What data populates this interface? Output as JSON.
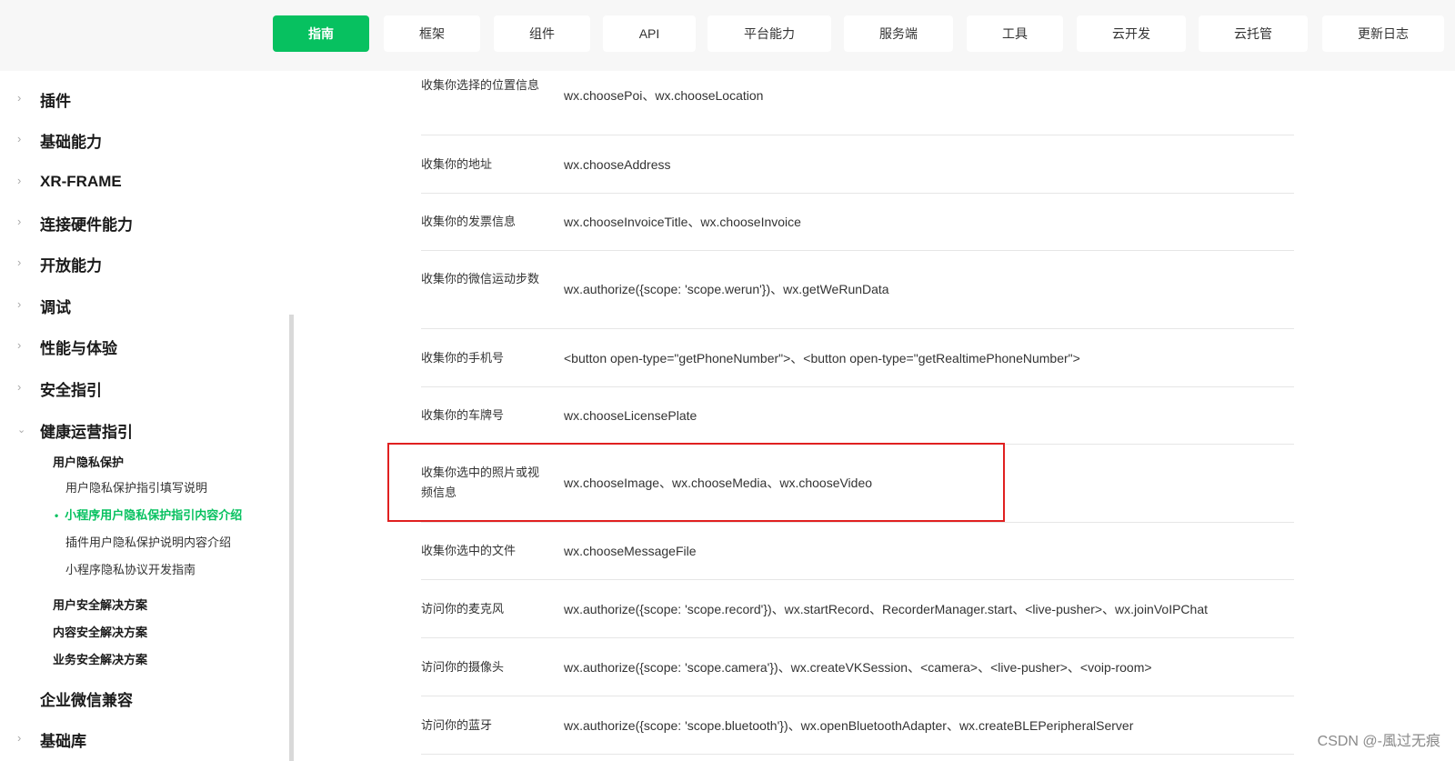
{
  "top_nav": {
    "tabs": [
      {
        "label": "指南",
        "active": true
      },
      {
        "label": "框架"
      },
      {
        "label": "组件"
      },
      {
        "label": "API"
      },
      {
        "label": "平台能力"
      },
      {
        "label": "服务端"
      },
      {
        "label": "工具"
      },
      {
        "label": "云开发"
      },
      {
        "label": "云托管"
      },
      {
        "label": "更新日志"
      }
    ]
  },
  "sidebar": {
    "items": [
      {
        "label": "插件"
      },
      {
        "label": "基础能力"
      },
      {
        "label": "XR-FRAME"
      },
      {
        "label": "连接硬件能力"
      },
      {
        "label": "开放能力"
      },
      {
        "label": "调试"
      },
      {
        "label": "性能与体验"
      },
      {
        "label": "安全指引"
      },
      {
        "label": "健康运营指引"
      }
    ],
    "sub": {
      "privacy_group": "用户隐私保护",
      "privacy_items": [
        "用户隐私保护指引填写说明",
        "小程序用户隐私保护指引内容介绍",
        "插件用户隐私保护说明内容介绍",
        "小程序隐私协议开发指南"
      ],
      "active_bullet": "•",
      "groups": [
        "用户安全解决方案",
        "内容安全解决方案",
        "业务安全解决方案"
      ]
    },
    "items_after": [
      {
        "label": "企业微信兼容"
      },
      {
        "label": "基础库"
      }
    ]
  },
  "table": {
    "rows": [
      {
        "scope": "收集你选择的位置信息",
        "apis": "wx.choosePoi、wx.chooseLocation"
      },
      {
        "scope": "收集你的地址",
        "apis": "wx.chooseAddress"
      },
      {
        "scope": "收集你的发票信息",
        "apis": "wx.chooseInvoiceTitle、wx.chooseInvoice"
      },
      {
        "scope": "收集你的微信运动步数",
        "apis": "wx.authorize({scope: 'scope.werun'})、wx.getWeRunData"
      },
      {
        "scope": "收集你的手机号",
        "apis": "<button open-type=\"getPhoneNumber\">、<button open-type=\"getRealtimePhoneNumber\">"
      },
      {
        "scope": "收集你的车牌号",
        "apis": "wx.chooseLicensePlate"
      },
      {
        "scope": "收集你选中的照片或视频信息",
        "apis": "wx.chooseImage、wx.chooseMedia、wx.chooseVideo"
      },
      {
        "scope": "收集你选中的文件",
        "apis": "wx.chooseMessageFile"
      },
      {
        "scope": "访问你的麦克风",
        "apis": "wx.authorize({scope: 'scope.record'})、wx.startRecord、RecorderManager.start、<live-pusher>、wx.joinVoIPChat"
      },
      {
        "scope": "访问你的摄像头",
        "apis": "wx.authorize({scope: 'scope.camera'})、wx.createVKSession、<camera>、<live-pusher>、<voip-room>"
      },
      {
        "scope": "访问你的蓝牙",
        "apis": "wx.authorize({scope: 'scope.bluetooth'})、wx.openBluetoothAdapter、wx.createBLEPeripheralServer"
      }
    ]
  },
  "watermark": "CSDN @-風过无痕",
  "colors": {
    "accent": "#07c160",
    "highlight": "#e02020"
  },
  "icons": {
    "collapsed": "chevron-right-icon",
    "expanded": "chevron-down-icon"
  }
}
